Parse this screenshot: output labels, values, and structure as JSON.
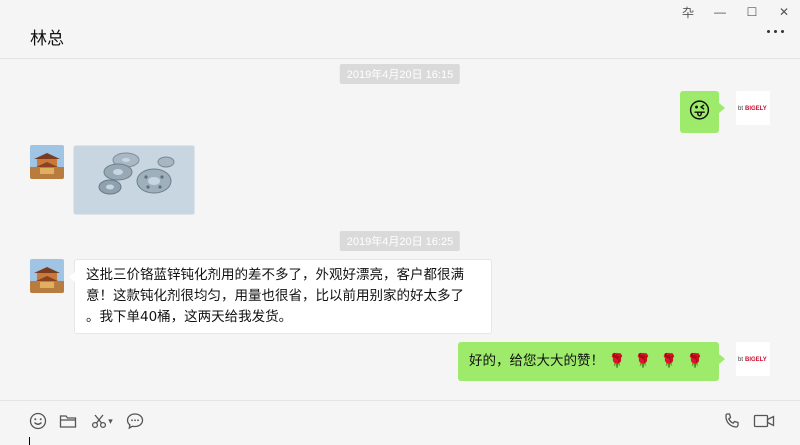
{
  "window": {
    "title": "林总",
    "controls": {
      "pin": "卆",
      "minimize": "—",
      "maximize": "☐",
      "close": "✕"
    }
  },
  "messages": [
    {
      "type": "timestamp",
      "text": "2019年4月20日 16:15"
    },
    {
      "type": "emoji",
      "side": "right",
      "emoji": "😜"
    },
    {
      "type": "image",
      "side": "left",
      "alt": ""
    },
    {
      "type": "timestamp",
      "text": "2019年4月20日 16:25"
    },
    {
      "type": "text",
      "side": "left",
      "lines": [
        "这批三价铬蓝锌钝化剂用的差不多了，外观好漂亮，客户都很满",
        "意！这款钝化剂很均匀，用量也很省，比以前用别家的好太多了",
        "。我下单40桶，这两天给我发货。"
      ]
    },
    {
      "type": "text",
      "side": "right",
      "text": "好的，给您大大的赞！",
      "roses": [
        "🌹",
        "🌹",
        "🌹",
        "🌹"
      ]
    }
  ],
  "avatars": {
    "self_brand": "BIGELY",
    "self_prefix": "bt"
  },
  "toolbar": {
    "icons": [
      "emoji-icon",
      "folder-icon",
      "scissors-icon",
      "chat-bubble-icon",
      "phone-icon",
      "video-icon"
    ],
    "scissors_dropdown": "▾"
  },
  "colors": {
    "sent_bubble": "#9eea6a",
    "received_bubble": "#ffffff",
    "background": "#f5f5f5",
    "timestamp_bg": "#dadada"
  }
}
